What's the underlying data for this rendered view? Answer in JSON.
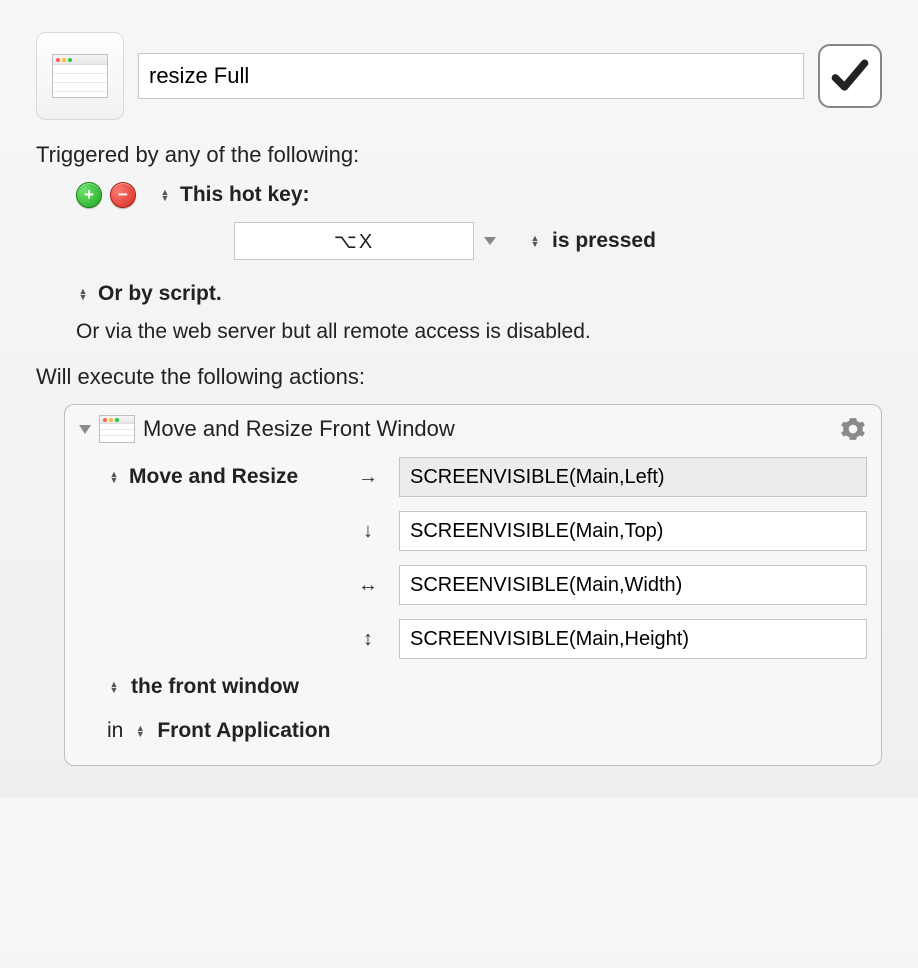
{
  "header": {
    "macro_name": "resize Full"
  },
  "trigger": {
    "section_label": "Triggered by any of the following:",
    "hotkey_label": "This hot key:",
    "hotkey_value": "⌥X",
    "pressed_label": "is pressed",
    "script_label": "Or by script.",
    "web_label": "Or via the web server but all remote access is disabled."
  },
  "actions": {
    "section_label": "Will execute the following actions:",
    "item": {
      "title": "Move and Resize Front Window",
      "operation_label": "Move and Resize",
      "params": {
        "left": {
          "arrow": "→",
          "value": "SCREENVISIBLE(Main,Left)"
        },
        "top": {
          "arrow": "↓",
          "value": "SCREENVISIBLE(Main,Top)"
        },
        "width": {
          "arrow": "↔",
          "value": "SCREENVISIBLE(Main,Width)"
        },
        "height": {
          "arrow": "↕",
          "value": "SCREENVISIBLE(Main,Height)"
        }
      },
      "target_label": "the front window",
      "in_label": "in",
      "app_label": "Front Application"
    }
  }
}
